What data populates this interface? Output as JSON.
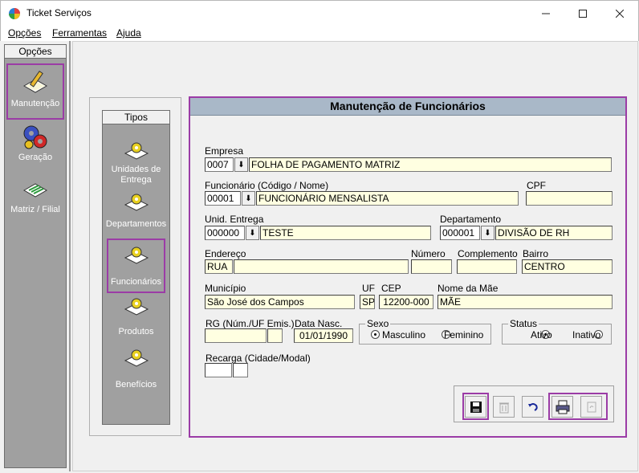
{
  "window": {
    "title": "Ticket Serviços",
    "minimize": "—",
    "maximize": "☐",
    "close": "✕"
  },
  "menu": [
    {
      "label": "Opções"
    },
    {
      "label": "Ferramentas"
    },
    {
      "label": "Ajuda"
    }
  ],
  "sidebar": {
    "header": "Opções",
    "items": [
      {
        "label": "Manutenção",
        "icon": "pencil-notepad-icon",
        "selected": true
      },
      {
        "label": "Geração",
        "icon": "gear-icon"
      },
      {
        "label": "Matriz / Filial",
        "icon": "pen-notepad-icon"
      }
    ]
  },
  "tipos": {
    "header": "Tipos",
    "items": [
      {
        "label": "Unidades de Entrega"
      },
      {
        "label": "Departamentos"
      },
      {
        "label": "Funcionários",
        "selected": true
      },
      {
        "label": "Produtos"
      },
      {
        "label": "Benefícios"
      }
    ]
  },
  "form": {
    "title": "Manutenção de Funcionários",
    "empresa": {
      "label": "Empresa",
      "code": "0007",
      "name": "FOLHA DE PAGAMENTO MATRIZ"
    },
    "funcionario": {
      "label": "Funcionário (Código / Nome)",
      "code": "00001",
      "name": "FUNCIONÁRIO MENSALISTA"
    },
    "cpf": {
      "label": "CPF",
      "value": ""
    },
    "unid_entrega": {
      "label": "Unid. Entrega",
      "code": "000000",
      "name": "TESTE"
    },
    "departamento": {
      "label": "Departamento",
      "code": "000001",
      "name": "DIVISÃO DE RH"
    },
    "endereco": {
      "label": "Endereço",
      "tipo": "RUA",
      "value": ""
    },
    "numero": {
      "label": "Número",
      "value": ""
    },
    "complemento": {
      "label": "Complemento",
      "value": ""
    },
    "bairro": {
      "label": "Bairro",
      "value": "CENTRO"
    },
    "municipio": {
      "label": "Município",
      "value": "São José dos Campos"
    },
    "uf": {
      "label": "UF",
      "value": "SP"
    },
    "cep": {
      "label": "CEP",
      "value": "12200-000"
    },
    "mae": {
      "label": "Nome da Mãe",
      "value": "MÃE"
    },
    "rg": {
      "label": "RG (Núm./UF Emis.)",
      "num": "",
      "uf": ""
    },
    "data_nasc": {
      "label": "Data Nasc.",
      "value": "01/01/1990"
    },
    "sexo": {
      "label": "Sexo",
      "options": [
        "Masculino",
        "Feminino"
      ],
      "selected": "Masculino"
    },
    "status": {
      "label": "Status",
      "options": [
        "Ativo",
        "Inativo"
      ],
      "selected": "Ativo"
    },
    "recarga": {
      "label": "Recarga (Cidade/Modal)",
      "cidade": "",
      "modal": ""
    }
  },
  "toolbar": {
    "buttons": [
      {
        "name": "save-button",
        "icon": "floppy-disk-icon",
        "enabled": true,
        "highlighted": true
      },
      {
        "name": "delete-button",
        "icon": "trash-icon",
        "enabled": false
      },
      {
        "name": "undo-button",
        "icon": "undo-icon",
        "enabled": true
      },
      {
        "name": "print-button",
        "icon": "printer-icon",
        "enabled": true,
        "highlighted": true
      },
      {
        "name": "refresh-button",
        "icon": "refresh-icon",
        "enabled": false,
        "highlighted": true
      }
    ]
  },
  "colors": {
    "highlight": "#9b3ca6",
    "field": "#ffffe1",
    "panel_header": "#a9b8c8",
    "sidebar": "#a0a0a0"
  }
}
